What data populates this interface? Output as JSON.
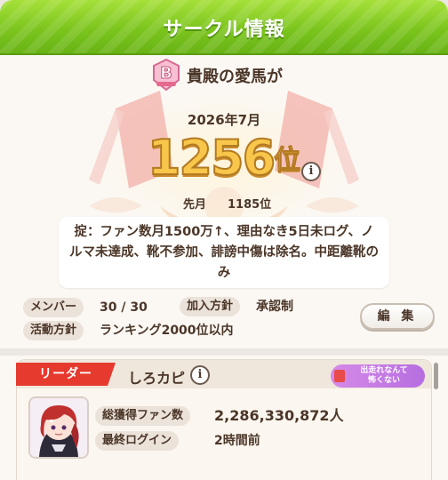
{
  "header": {
    "title": "サークル情報"
  },
  "circle": {
    "rank_letter": "B",
    "name": "貴殿の愛馬が",
    "month": "2026年7月",
    "rank_number": "1256",
    "rank_unit": "位",
    "info_symbol": "i",
    "last_month_label": "先月",
    "last_month_value": "1185位",
    "rules": "掟：ファン数月1500万↑、理由なき5日未ログ、ノルマ未達成、靴不参加、誹謗中傷は除名。中距離靴のみ"
  },
  "details": {
    "members_label": "メンバー",
    "members_value": "30 / 30",
    "join_policy_label": "加入方針",
    "join_policy_value": "承認制",
    "activity_label": "活動方針",
    "activity_value": "ランキング2000位以内",
    "edit_button": "編 集"
  },
  "leader": {
    "ribbon_label": "リーダー",
    "name": "しろカピ",
    "status_line1": "出走れなんて",
    "status_line2": "怖くない",
    "total_fans_label": "総獲得ファン数",
    "total_fans_value": "2,286,330,872人",
    "last_login_label": "最終ログイン",
    "last_login_value": "2時間前"
  },
  "colors": {
    "header_green": "#7cc51e",
    "rank_gold": "#f7c64a",
    "ribbon_red": "#e63a2e",
    "status_purple": "#c37ae4"
  }
}
